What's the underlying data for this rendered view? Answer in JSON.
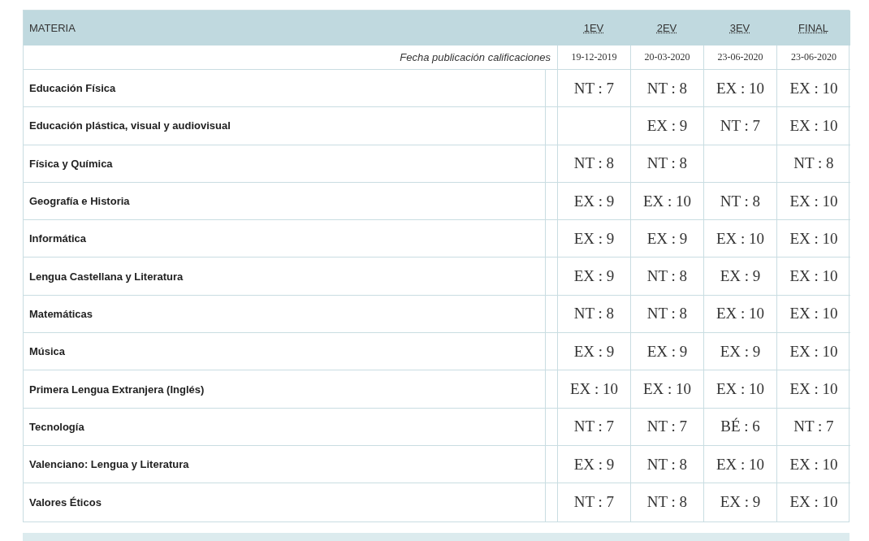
{
  "table": {
    "columns": [
      "MATERIA",
      "1EV",
      "2EV",
      "3EV",
      "FINAL"
    ],
    "dates_label": "Fecha publicación calificaciones",
    "dates": [
      "19-12-2019",
      "20-03-2020",
      "23-06-2020",
      "23-06-2020"
    ],
    "rows": [
      {
        "subject": "Educación Física",
        "grades": {
          "ev1": "NT : 7",
          "ev2": "NT : 8",
          "ev3": "EX : 10",
          "final": "EX : 10"
        }
      },
      {
        "subject": "Educación plástica, visual y audiovisual",
        "grades": {
          "ev2": "EX : 9",
          "ev3": "NT : 7",
          "final": "EX : 10"
        }
      },
      {
        "subject": "Física y Química",
        "grades": {
          "ev1": "NT : 8",
          "ev2": "NT : 8",
          "final": "NT : 8"
        }
      },
      {
        "subject": "Geografía e Historia",
        "grades": {
          "ev1": "EX : 9",
          "ev2": "EX : 10",
          "ev3": "NT : 8",
          "final": "EX : 10"
        }
      },
      {
        "subject": "Informática",
        "grades": {
          "ev1": "EX : 9",
          "ev2": "EX : 9",
          "ev3": "EX : 10",
          "final": "EX : 10"
        }
      },
      {
        "subject": "Lengua Castellana y Literatura",
        "grades": {
          "ev1": "EX : 9",
          "ev2": "NT : 8",
          "ev3": "EX : 9",
          "final": "EX : 10"
        }
      },
      {
        "subject": "Matemáticas",
        "grades": {
          "ev1": "NT : 8",
          "ev2": "NT : 8",
          "ev3": "EX : 10",
          "final": "EX : 10"
        }
      },
      {
        "subject": "Música",
        "grades": {
          "ev1": "EX : 9",
          "ev2": "EX : 9",
          "ev3": "EX : 9",
          "final": "EX : 10"
        }
      },
      {
        "subject": "Primera Lengua Extranjera (Inglés)",
        "grades": {
          "ev1": "EX : 10",
          "ev2": "EX : 10",
          "ev3": "EX : 10",
          "final": "EX : 10"
        }
      },
      {
        "subject": "Tecnología",
        "grades": {
          "ev1": "NT : 7",
          "ev2": "NT : 7",
          "ev3": "BÉ : 6",
          "final": "NT : 7"
        }
      },
      {
        "subject": "Valenciano: Lengua y Literatura",
        "grades": {
          "ev1": "EX : 9",
          "ev2": "NT : 8",
          "ev3": "EX : 10",
          "final": "EX : 10"
        }
      },
      {
        "subject": "Valores Éticos",
        "grades": {
          "ev1": "NT : 7",
          "ev2": "NT : 8",
          "ev3": "EX : 9",
          "final": "EX : 10"
        }
      }
    ]
  }
}
